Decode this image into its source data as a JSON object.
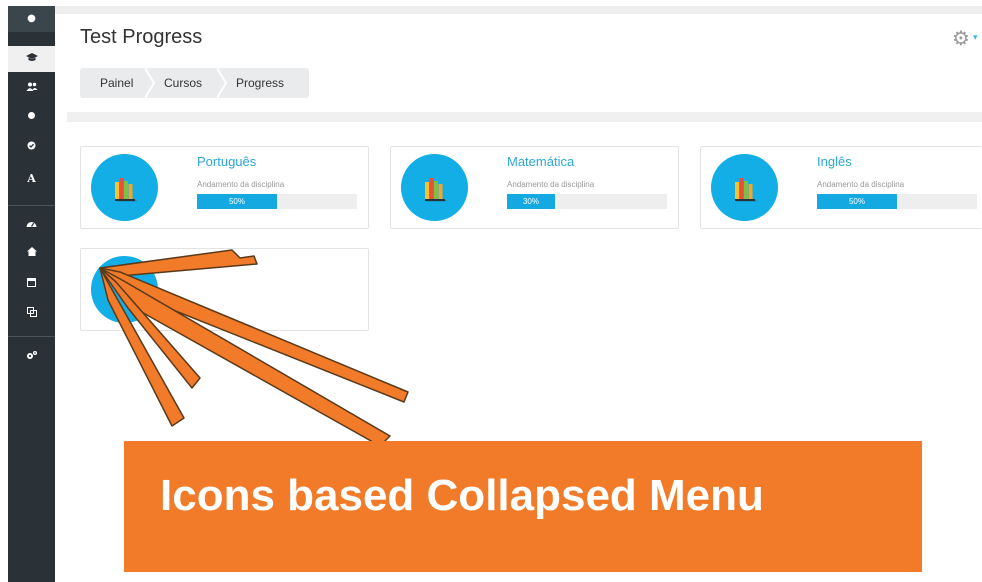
{
  "page": {
    "title": "Test Progress"
  },
  "breadcrumb": [
    "Painel",
    "Cursos",
    "Progress"
  ],
  "sidebar": {
    "items": [
      {
        "name": "toggle-icon",
        "glyph": "●",
        "active": false
      },
      {
        "name": "graduation-cap-icon",
        "glyph": "🎓",
        "active": true
      },
      {
        "name": "users-icon",
        "glyph": "👥",
        "active": false
      },
      {
        "name": "circle-icon",
        "glyph": "●",
        "active": false
      },
      {
        "name": "check-circle-icon",
        "glyph": "✔",
        "active": false
      },
      {
        "name": "letter-a-icon",
        "glyph": "A",
        "active": false
      },
      {
        "name": "dashboard-icon",
        "glyph": "◕",
        "active": false
      },
      {
        "name": "home-icon",
        "glyph": "⌂",
        "active": false
      },
      {
        "name": "calendar-icon",
        "glyph": "▦",
        "active": false
      },
      {
        "name": "copy-icon",
        "glyph": "⧉",
        "active": false
      },
      {
        "name": "cogs-icon",
        "glyph": "⚙",
        "active": false
      }
    ]
  },
  "courses": [
    {
      "name": "Português",
      "progress_label": "Andamento da disciplina",
      "percent": 50,
      "percent_text": "50%"
    },
    {
      "name": "Matemática",
      "progress_label": "Andamento da disciplina",
      "percent": 30,
      "percent_text": "30%"
    },
    {
      "name": "Inglês",
      "progress_label": "Andamento da disciplina",
      "percent": 50,
      "percent_text": "50%"
    }
  ],
  "annotation": {
    "text": "Icons based Collapsed Menu"
  },
  "colors": {
    "sidebar": "#2a3238",
    "accent": "#13aee5",
    "progress": "#15a9e1",
    "annotation": "#f27b2a"
  }
}
